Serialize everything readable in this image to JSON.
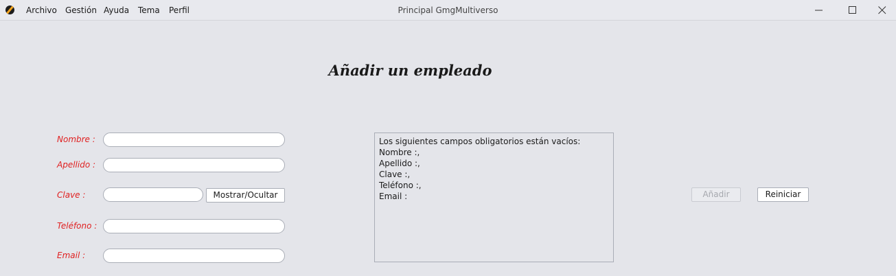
{
  "window": {
    "title": "Principal GmgMultiverso",
    "menu": [
      "Archivo",
      "Gestión",
      "Ayuda",
      "Tema",
      "Perfil"
    ]
  },
  "form": {
    "heading": "Añadir un empleado",
    "labels": {
      "nombre": "Nombre :",
      "apellido": "Apellido :",
      "clave": "Clave :",
      "telefono": "Teléfono :",
      "email": "Email :"
    },
    "values": {
      "nombre": "",
      "apellido": "",
      "clave": "",
      "telefono": "",
      "email": ""
    },
    "toggle_password_label": "Mostrar/Ocultar",
    "add_label": "Añadir",
    "reset_label": "Reiniciar",
    "label_color": "#e02020"
  },
  "validation": {
    "lines": [
      "Los siguientes campos obligatorios están vacíos:",
      "Nombre :,",
      "Apellido :,",
      "Clave :,",
      "Teléfono :,",
      "Email :"
    ]
  }
}
